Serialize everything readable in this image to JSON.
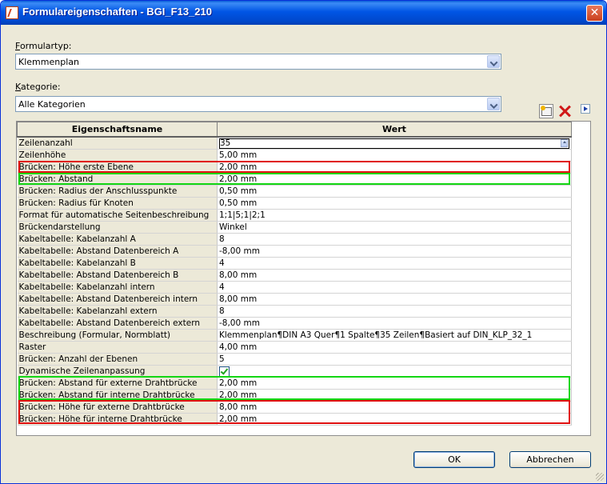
{
  "window": {
    "title": "Formulareigenschaften - BGI_F13_210",
    "close_glyph": "✕"
  },
  "formulartyp": {
    "label_mnemonic": "F",
    "label_rest": "ormulartyp:",
    "value": "Klemmenplan"
  },
  "kategorie": {
    "label_mnemonic": "K",
    "label_rest": "ategorie:",
    "value": "Alle Kategorien"
  },
  "grid": {
    "header_name": "Eigenschaftsname",
    "header_value": "Wert",
    "rows": [
      {
        "name": "Zeilenanzahl",
        "value": "35"
      },
      {
        "name": "Zeilenhöhe",
        "value": "5,00 mm"
      },
      {
        "name": "Brücken: Höhe erste Ebene",
        "value": "2,00 mm"
      },
      {
        "name": "Brücken: Abstand",
        "value": "2,00 mm"
      },
      {
        "name": "Brücken: Radius der Anschlusspunkte",
        "value": "0,50 mm"
      },
      {
        "name": "Brücken: Radius für Knoten",
        "value": "0,50 mm"
      },
      {
        "name": "Format für automatische Seitenbeschreibung",
        "value": "1;1|5;1|2;1"
      },
      {
        "name": "Brückendarstellung",
        "value": "Winkel"
      },
      {
        "name": "Kabeltabelle: Kabelanzahl A",
        "value": "8"
      },
      {
        "name": "Kabeltabelle: Abstand Datenbereich A",
        "value": "-8,00 mm"
      },
      {
        "name": "Kabeltabelle: Kabelanzahl B",
        "value": "4"
      },
      {
        "name": "Kabeltabelle: Abstand Datenbereich B",
        "value": "8,00 mm"
      },
      {
        "name": "Kabeltabelle: Kabelanzahl intern",
        "value": "4"
      },
      {
        "name": "Kabeltabelle: Abstand Datenbereich intern",
        "value": "8,00 mm"
      },
      {
        "name": "Kabeltabelle: Kabelanzahl extern",
        "value": "8"
      },
      {
        "name": "Kabeltabelle: Abstand Datenbereich extern",
        "value": "-8,00 mm"
      },
      {
        "name": "Beschreibung (Formular, Normblatt)",
        "value": "Klemmenplan¶DIN A3 Quer¶1 Spalte¶35 Zeilen¶Basiert auf DIN_KLP_32_1"
      },
      {
        "name": "Raster",
        "value": "4,00 mm"
      },
      {
        "name": "Brücken: Anzahl der Ebenen",
        "value": "5"
      },
      {
        "name": "Dynamische Zeilenanpassung",
        "value": "",
        "checked": true
      },
      {
        "name": "Brücken: Abstand für externe Drahtbrücke",
        "value": "2,00 mm"
      },
      {
        "name": "Brücken: Abstand für interne Drahtbrücke",
        "value": "2,00 mm"
      },
      {
        "name": "Brücken: Höhe für externe Drahtbrücke",
        "value": "8,00 mm"
      },
      {
        "name": "Brücken: Höhe für interne Drahtbrücke",
        "value": "2,00 mm"
      }
    ]
  },
  "buttons": {
    "ok": "OK",
    "cancel": "Abbrechen"
  },
  "colors": {
    "highlight_red": "#e01010",
    "highlight_green": "#13d613"
  }
}
